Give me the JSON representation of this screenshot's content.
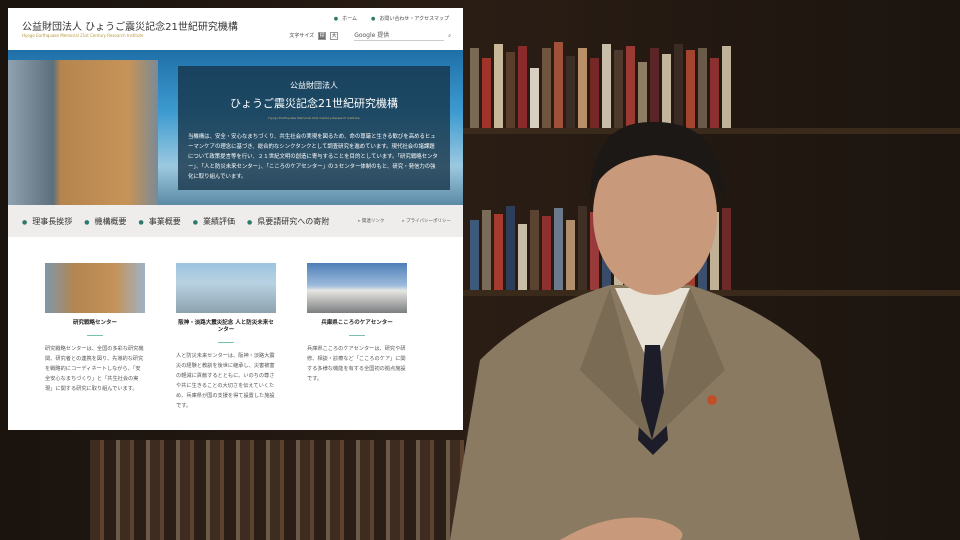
{
  "header": {
    "title": "公益財団法人 ひょうご震災記念21世紀研究機構",
    "subtitle": "Hyogo Earthquake Memorial 21st Century Research Institute",
    "links": [
      "ホーム",
      "お問い合わせ・アクセスマップ"
    ],
    "font_size_label": "文字サイズ",
    "size_small": "標",
    "size_large": "大",
    "search_placeholder": "Google 提供"
  },
  "hero": {
    "line1": "公益財団法人",
    "line2": "ひょうご震災記念21世紀研究機構",
    "line3": "Hyogo Earthquake Memorial 21st Century Research Institute",
    "body": "当機構は、安全・安心なまちづくり、共生社会の実現を図るため、命の尊厳と生きる歓びを高めるヒューマンケアの理念に基づき、総合的なシンクタンクとして調査研究を進めています。現代社会の諸課題について政策提言等を行い、２１世紀文明の創造に寄与することを目的としています。「研究戦略センター」、「人と防災未来センター」、「こころのケアセンター」の３センター体制のもと、研究・発信力の強化に取り組んでいます。"
  },
  "nav": {
    "items": [
      "理事長挨拶",
      "機構概要",
      "事業概要",
      "業績評価",
      "県要請研究への寄附"
    ],
    "right": [
      "関連リンク",
      "プライバシーポリシー"
    ]
  },
  "cards": [
    {
      "title": "研究戦略センター",
      "text": "研究戦略センターは、全国の多彩な研究機関、研究者との連携を図り、先導的な研究を戦略的にコーディネートしながら、「安全安心なまちづくり」と「共生社会の実現」に関する研究に取り組んでいます。"
    },
    {
      "title": "阪神・淡路大震災記念 人と防災未来センター",
      "text": "人と防災未来センターは、阪神・淡路大震災の経験と教訓を後世に継承し、災害被害の軽減に貢献するとともに、いのちの尊さや共に生きることの大切さを伝えていくため、兵庫県が国の支援を得て設置した施設です。"
    },
    {
      "title": "兵庫県こころのケアセンター",
      "text": "兵庫県こころのケアセンターは、研究や研修、相談・診療など「こころのケア」に関する多様な機能を有する全国初の拠点施設です。"
    }
  ]
}
